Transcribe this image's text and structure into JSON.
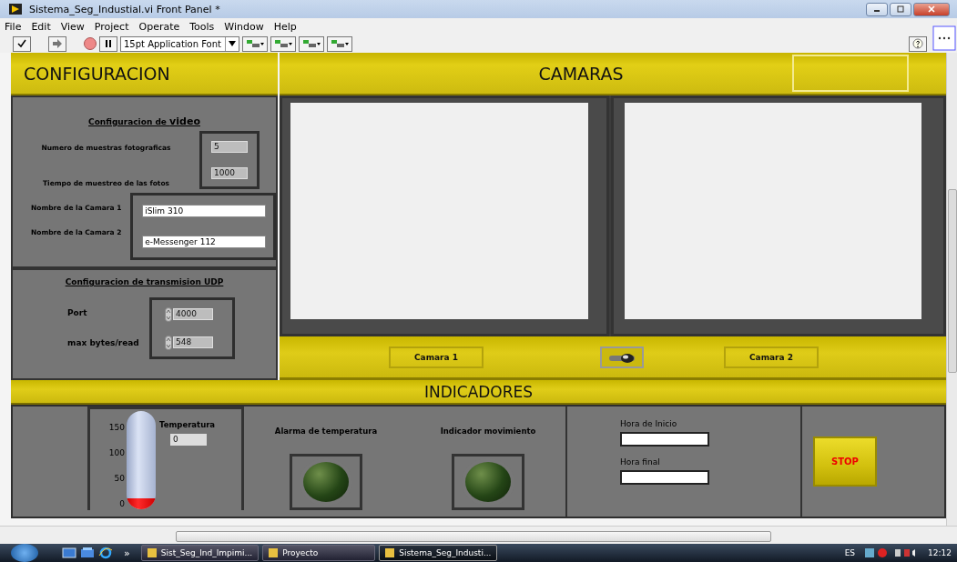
{
  "window": {
    "title": "Sistema_Seg_Industial.vi Front Panel *"
  },
  "menu": [
    "File",
    "Edit",
    "View",
    "Project",
    "Operate",
    "Tools",
    "Window",
    "Help"
  ],
  "toolbar": {
    "font": "15pt Application Font"
  },
  "config_header": "CONFIGURACION",
  "cameras_header": "CAMARAS",
  "video_config": {
    "title": "Configuracion de **video**",
    "fields": [
      {
        "label": "Numero de muestras fotograficas",
        "value": "5"
      },
      {
        "label": "Tiempo de muestreo de las fotos",
        "value": "1000"
      }
    ],
    "names": [
      {
        "label": "Nombre de la Camara 1",
        "value": "iSlim 310"
      },
      {
        "label": "Nombre de la Camara 2",
        "value": "e-Messenger 112"
      }
    ]
  },
  "udp_config": {
    "title": "Configuracion de transmision UDP",
    "fields": [
      {
        "label": "Port",
        "value": "4000"
      },
      {
        "label": "max bytes/read",
        "value": "548"
      }
    ]
  },
  "camera_select": {
    "left": "Camara 1",
    "right": "Camara 2",
    "on": true
  },
  "indicators_header": "INDICADORES",
  "temperature": {
    "label": "Temperatura",
    "value": "0",
    "level": 0,
    "scale": [
      "150",
      "100",
      "50",
      "0"
    ]
  },
  "leds": [
    {
      "label": "Alarma de temperatura",
      "on": false
    },
    {
      "label": "Indicador movimiento",
      "on": false
    }
  ],
  "times": [
    {
      "label": "Hora de Inicio"
    },
    {
      "label": "Hora final"
    }
  ],
  "stop_button": "STOP",
  "taskbar": {
    "items": [
      {
        "label": "Sist_Seg_Ind_Impimi...",
        "selected": false
      },
      {
        "label": "Proyecto",
        "selected": false
      },
      {
        "label": "Sistema_Seg_Industi...",
        "selected": true
      }
    ],
    "language": "ES",
    "clock": "12:12",
    "chevron": "»"
  }
}
